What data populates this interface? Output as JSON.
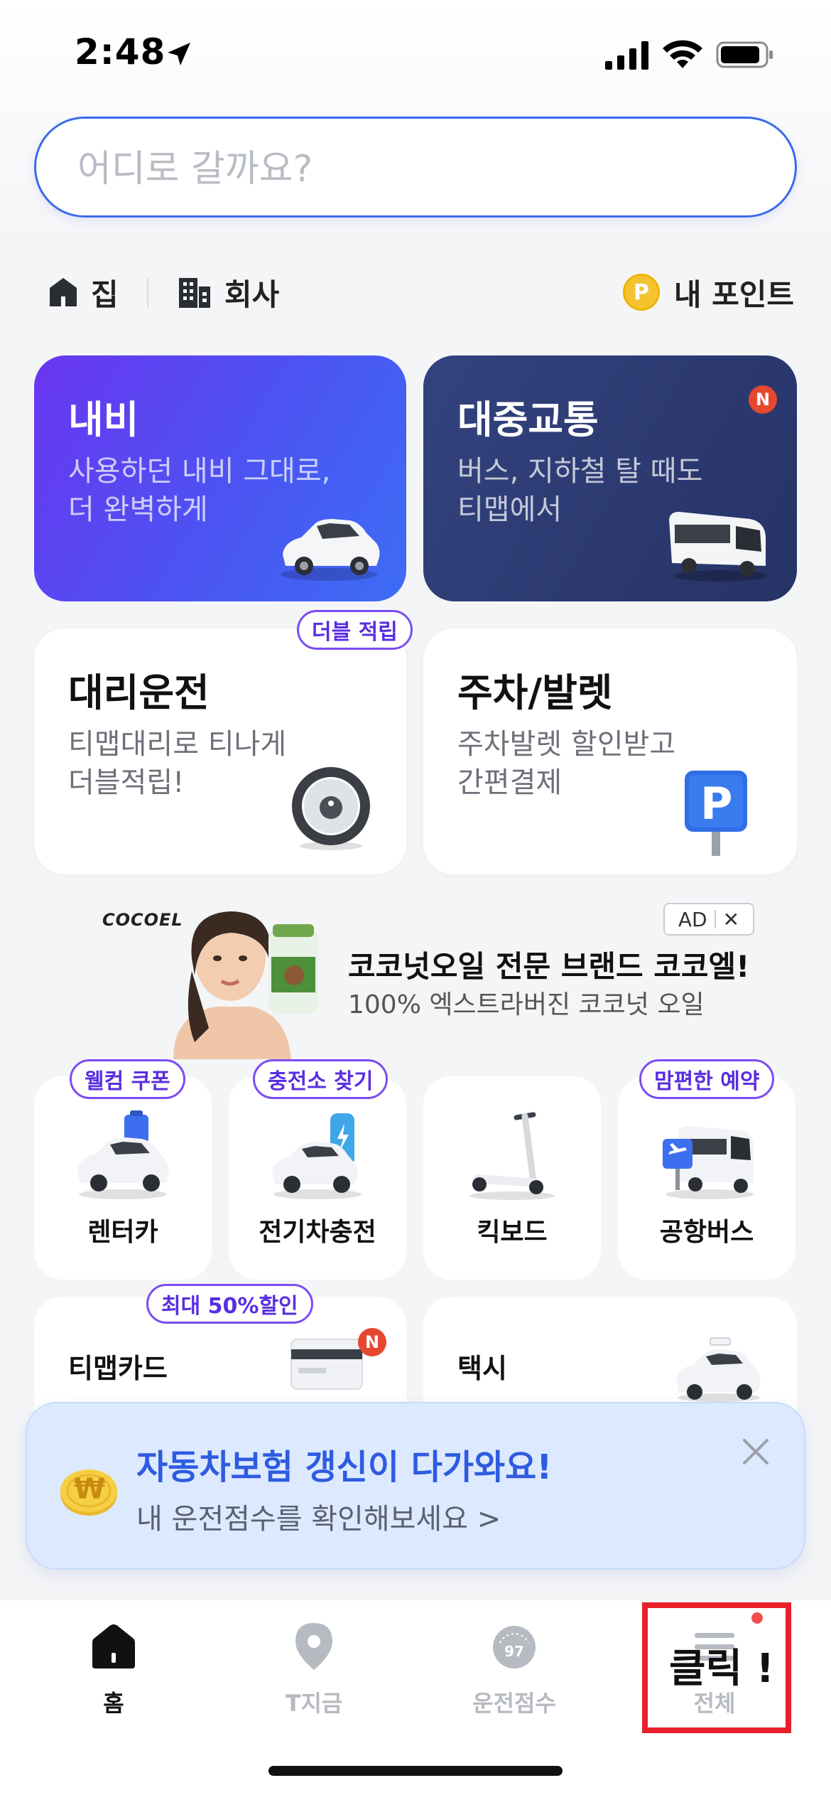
{
  "status_bar": {
    "time": "2:48"
  },
  "search": {
    "placeholder": "어디로 갈까요?"
  },
  "shortcuts": {
    "home": "집",
    "work": "회사",
    "points": "내 포인트",
    "points_coin": "P"
  },
  "cards": {
    "navigation": {
      "title": "내비",
      "desc_line1": "사용하던 내비 그대로,",
      "desc_line2": "더 완벽하게"
    },
    "transit": {
      "title": "대중교통",
      "desc_line1": "버스, 지하철 탈 때도",
      "desc_line2": "티맵에서",
      "new_badge": "N"
    },
    "driver": {
      "title": "대리운전",
      "desc_line1": "티맵대리로 티나게",
      "desc_line2": "더블적립!",
      "badge": "더블 적립"
    },
    "parking": {
      "title": "주차/발렛",
      "desc_line1": "주차발렛 할인받고",
      "desc_line2": "간편결제",
      "sign": "P"
    }
  },
  "ad": {
    "brand_logo": "COCOEL",
    "tag": "AD",
    "close": "✕",
    "title": "코코넛오일 전문 브랜드 코코엘!",
    "subtitle": "100% 엑스트라버진 코코넛 오일"
  },
  "services": [
    {
      "label": "렌터카",
      "badge": "웰컴 쿠폰"
    },
    {
      "label": "전기차충전",
      "badge": "충전소 찾기"
    },
    {
      "label": "킥보드",
      "badge": ""
    },
    {
      "label": "공항버스",
      "badge": "맘편한 예약"
    }
  ],
  "row_cards": {
    "tmap_card": {
      "label": "티맵카드",
      "badge": "최대 50%할인",
      "new_badge": "N"
    },
    "taxi": {
      "label": "택시"
    }
  },
  "banner": {
    "title": "자동차보험 갱신이 다가와요!",
    "subtitle": "내 운전점수를 확인해보세요 >",
    "coin": "₩"
  },
  "tabs": [
    {
      "label": "홈",
      "active": true
    },
    {
      "label": "T지금",
      "active": false
    },
    {
      "label": "운전점수",
      "active": false,
      "score": "97"
    },
    {
      "label": "전체",
      "active": false
    }
  ],
  "annotation": {
    "click_text": "클릭 !"
  },
  "colors": {
    "accent": "#3b6be8",
    "purple": "#6a36f0",
    "navy": "#2a3870",
    "alert_red": "#e8202a"
  }
}
